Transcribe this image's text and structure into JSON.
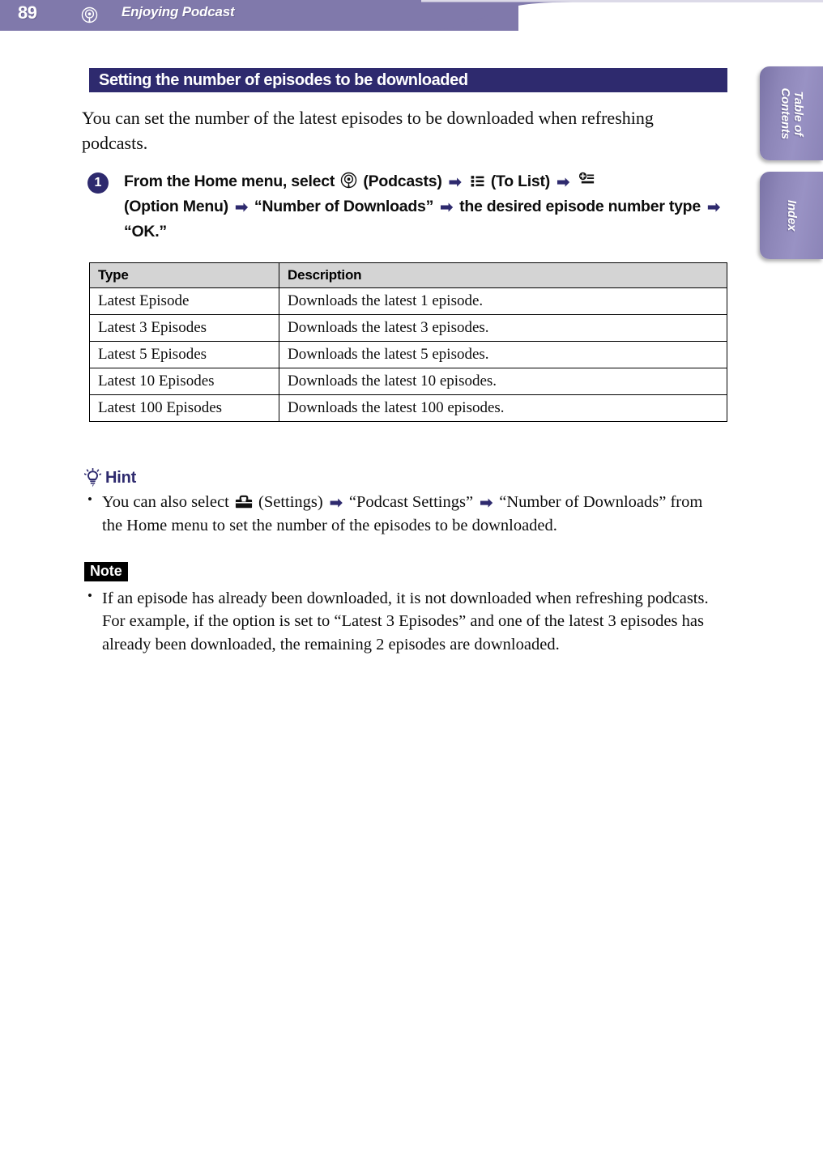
{
  "header": {
    "page_number": "89",
    "chapter_title": "Enjoying Podcast",
    "podcast_icon": "podcast-icon",
    "bar_color": "#8079ab"
  },
  "side_tabs": [
    {
      "label": "Table of\nContents",
      "name": "table-of-contents"
    },
    {
      "label": "Index",
      "name": "index"
    }
  ],
  "section": {
    "title": "Setting the number of episodes to be downloaded",
    "title_bar_color": "#2e2a6e",
    "intro": "You can set the number of the latest episodes to be downloaded when refreshing podcasts."
  },
  "step": {
    "number": "1",
    "part1": "From the Home menu, select",
    "podcasts_label": "(Podcasts)",
    "to_list_label": "(To List)",
    "option_menu_label": "(Option Menu)",
    "downloads_label": "“Number of Downloads”",
    "episode_type_label": "the desired episode number type",
    "ok_label": "“OK.”",
    "arrow_glyph": "➡"
  },
  "table": {
    "headers": [
      "Type",
      "Description"
    ],
    "rows": [
      [
        "Latest Episode",
        "Downloads the latest 1 episode."
      ],
      [
        "Latest 3 Episodes",
        "Downloads the latest 3 episodes."
      ],
      [
        "Latest 5 Episodes",
        "Downloads the latest 5 episodes."
      ],
      [
        "Latest 10 Episodes",
        "Downloads the latest 10 episodes."
      ],
      [
        "Latest 100 Episodes",
        "Downloads the latest 100 episodes."
      ]
    ],
    "header_bg": "#d4d4d4"
  },
  "hint": {
    "label": "Hint",
    "icon": "lightbulb-icon",
    "text_before_icon": "You can also select",
    "settings_label": "(Settings)",
    "podcast_settings_label": "“Podcast Settings”",
    "downloads_label": "“Number of Downloads”",
    "text_after": "from the Home menu to set the number of the episodes to be downloaded."
  },
  "note": {
    "label": "Note",
    "text": "If an episode has already been downloaded, it is not downloaded when refreshing podcasts. For example, if the option is set to “Latest 3 Episodes” and one of the latest 3 episodes has already been downloaded, the remaining 2 episodes are downloaded."
  }
}
